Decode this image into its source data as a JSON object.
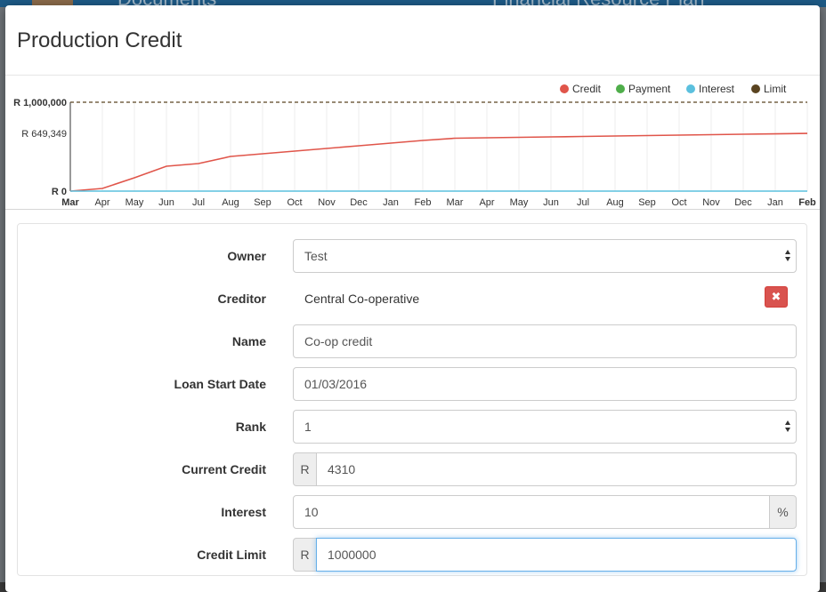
{
  "background": {
    "left_heading": "Documents",
    "right_heading": "Financial Resource Plan"
  },
  "modal": {
    "title": "Production Credit"
  },
  "chart_data": {
    "type": "line",
    "x": [
      "Mar",
      "Apr",
      "May",
      "Jun",
      "Jul",
      "Aug",
      "Sep",
      "Oct",
      "Nov",
      "Dec",
      "Jan",
      "Feb",
      "Mar",
      "Apr",
      "May",
      "Jun",
      "Jul",
      "Aug",
      "Sep",
      "Oct",
      "Nov",
      "Dec",
      "Jan",
      "Feb"
    ],
    "x_bold_ticks": [
      0,
      23
    ],
    "y_ticks": [
      "R 1,000,000",
      "R 649,349",
      "R 0"
    ],
    "y_tick_values": [
      1000000,
      649349,
      0
    ],
    "ylim": [
      0,
      1000000
    ],
    "legend": [
      {
        "name": "Credit",
        "color": "#e0554a"
      },
      {
        "name": "Payment",
        "color": "#4fae4a"
      },
      {
        "name": "Interest",
        "color": "#5bc0de"
      },
      {
        "name": "Limit",
        "color": "#5a4420"
      }
    ],
    "legend_position": "top-right",
    "series": [
      {
        "name": "Credit",
        "color": "#e0554a",
        "values": [
          0,
          30000,
          150000,
          280000,
          310000,
          390000,
          420000,
          450000,
          480000,
          510000,
          540000,
          570000,
          595000,
          600000,
          605000,
          610000,
          615000,
          620000,
          625000,
          630000,
          635000,
          640000,
          644000,
          649349
        ]
      },
      {
        "name": "Interest",
        "color": "#5bc0de",
        "values": [
          0,
          0,
          0,
          0,
          0,
          0,
          0,
          0,
          0,
          0,
          0,
          0,
          0,
          0,
          0,
          0,
          0,
          0,
          0,
          0,
          0,
          0,
          0,
          0
        ]
      },
      {
        "name": "Limit",
        "color": "#5a4420",
        "style": "dashed",
        "values": [
          1000000,
          1000000,
          1000000,
          1000000,
          1000000,
          1000000,
          1000000,
          1000000,
          1000000,
          1000000,
          1000000,
          1000000,
          1000000,
          1000000,
          1000000,
          1000000,
          1000000,
          1000000,
          1000000,
          1000000,
          1000000,
          1000000,
          1000000,
          1000000
        ]
      }
    ],
    "grid": true
  },
  "form": {
    "owner": {
      "label": "Owner",
      "value": "Test"
    },
    "creditor": {
      "label": "Creditor",
      "value": "Central Co-operative",
      "remove_icon": "✖"
    },
    "name": {
      "label": "Name",
      "value": "Co-op credit"
    },
    "loan_start_date": {
      "label": "Loan Start Date",
      "value": "01/03/2016"
    },
    "rank": {
      "label": "Rank",
      "value": "1"
    },
    "current_credit": {
      "label": "Current Credit",
      "prefix": "R",
      "value": "4310"
    },
    "interest": {
      "label": "Interest",
      "value": "10",
      "suffix": "%"
    },
    "credit_limit": {
      "label": "Credit Limit",
      "prefix": "R",
      "value": "1000000"
    }
  }
}
